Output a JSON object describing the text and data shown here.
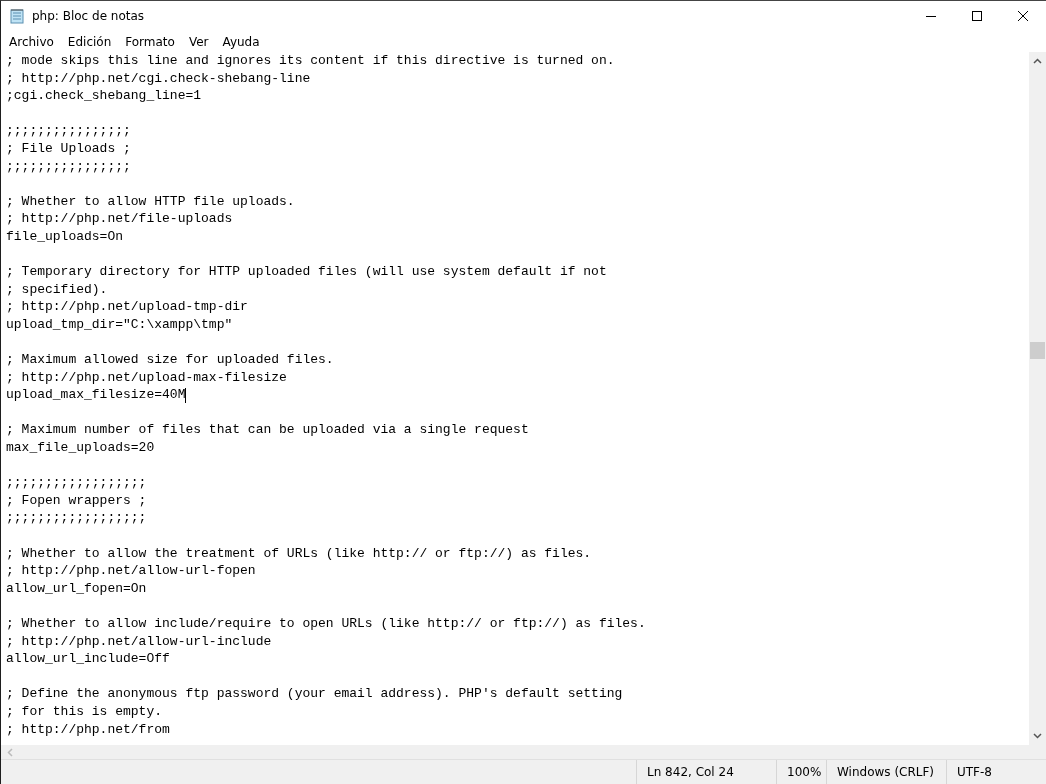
{
  "window": {
    "title": "php: Bloc de notas"
  },
  "menu": [
    "Archivo",
    "Edición",
    "Formato",
    "Ver",
    "Ayuda"
  ],
  "lines": [
    {
      "kind": "text",
      "text": "; mode skips this line and ignores its content if this directive is turned on."
    },
    {
      "kind": "text",
      "text": "; http://php.net/cgi.check-shebang-line"
    },
    {
      "kind": "text",
      "text": ";cgi.check_shebang_line=1"
    },
    {
      "kind": "blank"
    },
    {
      "kind": "text",
      "text": ";;;;;;;;;;;;;;;;"
    },
    {
      "kind": "text",
      "text": "; File Uploads ;"
    },
    {
      "kind": "text",
      "text": ";;;;;;;;;;;;;;;;"
    },
    {
      "kind": "blank"
    },
    {
      "kind": "text",
      "text": "; Whether to allow HTTP file uploads."
    },
    {
      "kind": "text",
      "text": "; http://php.net/file-uploads"
    },
    {
      "kind": "text",
      "text": "file_uploads=On"
    },
    {
      "kind": "blank"
    },
    {
      "kind": "text",
      "text": "; Temporary directory for HTTP uploaded files (will use system default if not"
    },
    {
      "kind": "text",
      "text": "; specified)."
    },
    {
      "kind": "text",
      "text": "; http://php.net/upload-tmp-dir"
    },
    {
      "kind": "text",
      "text": "upload_tmp_dir=\"C:\\xampp\\tmp\""
    },
    {
      "kind": "blank"
    },
    {
      "kind": "text",
      "text": "; Maximum allowed size for uploaded files."
    },
    {
      "kind": "text",
      "text": "; http://php.net/upload-max-filesize"
    },
    {
      "kind": "text",
      "text": "upload_max_filesize=40M",
      "cursor": true
    },
    {
      "kind": "blank"
    },
    {
      "kind": "text",
      "text": "; Maximum number of files that can be uploaded via a single request"
    },
    {
      "kind": "text",
      "text": "max_file_uploads=20"
    },
    {
      "kind": "blank"
    },
    {
      "kind": "text",
      "text": ";;;;;;;;;;;;;;;;;;"
    },
    {
      "kind": "text",
      "text": "; Fopen wrappers ;"
    },
    {
      "kind": "text",
      "text": ";;;;;;;;;;;;;;;;;;"
    },
    {
      "kind": "blank"
    },
    {
      "kind": "text",
      "text": "; Whether to allow the treatment of URLs (like http:// or ftp://) as files."
    },
    {
      "kind": "text",
      "text": "; http://php.net/allow-url-fopen"
    },
    {
      "kind": "text",
      "text": "allow_url_fopen=On"
    },
    {
      "kind": "blank"
    },
    {
      "kind": "text",
      "text": "; Whether to allow include/require to open URLs (like http:// or ftp://) as files."
    },
    {
      "kind": "text",
      "text": "; http://php.net/allow-url-include"
    },
    {
      "kind": "text",
      "text": "allow_url_include=Off"
    },
    {
      "kind": "blank"
    },
    {
      "kind": "text",
      "text": "; Define the anonymous ftp password (your email address). PHP's default setting"
    },
    {
      "kind": "text",
      "text": "; for this is empty."
    },
    {
      "kind": "text",
      "text": "; http://php.net/from"
    }
  ],
  "status_bar": {
    "position": "Ln 842, Col 24",
    "zoom": "100%",
    "line_endings": "Windows (CRLF)",
    "encoding": "UTF-8"
  }
}
